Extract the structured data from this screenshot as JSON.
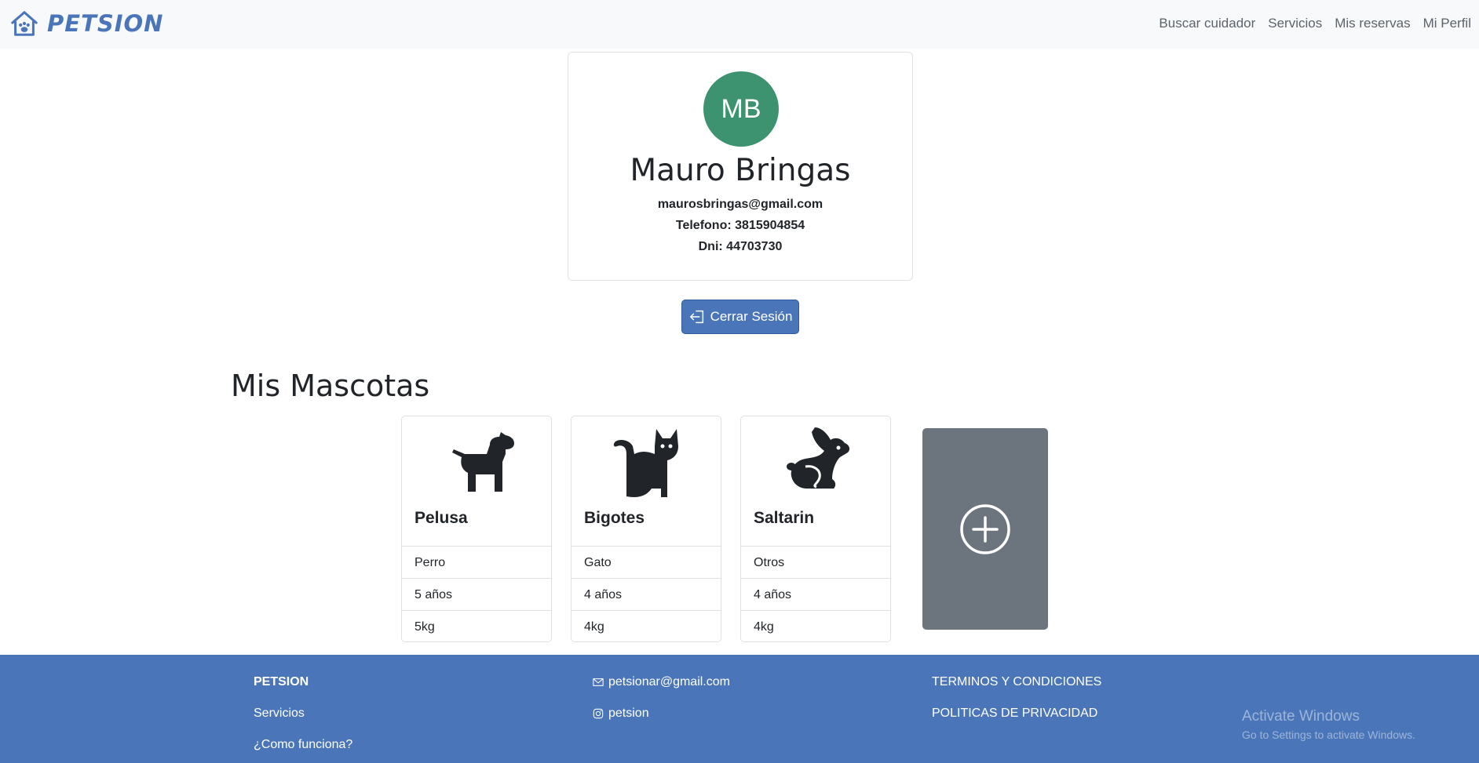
{
  "navbar": {
    "brand": "PETSION",
    "links": [
      "Buscar cuidador",
      "Servicios",
      "Mis reservas",
      "Mi Perfil"
    ]
  },
  "profile": {
    "initials": "MB",
    "name": "Mauro Bringas",
    "email": "maurosbringas@gmail.com",
    "phone": "Telefono: 3815904854",
    "dni": "Dni: 44703730",
    "avatar_color": "#3d9270"
  },
  "logout_label": "Cerrar Sesión",
  "pets_title": "Mis Mascotas",
  "pets": [
    {
      "name": "Pelusa",
      "type": "Perro",
      "age": "5 años",
      "weight": "5kg",
      "icon": "dog-icon"
    },
    {
      "name": "Bigotes",
      "type": "Gato",
      "age": "4 años",
      "weight": "4kg",
      "icon": "cat-icon"
    },
    {
      "name": "Saltarin",
      "type": "Otros",
      "age": "4 años",
      "weight": "4kg",
      "icon": "rabbit-icon"
    }
  ],
  "add_pet_icon": "plus-circle-icon",
  "footer": {
    "brand": "PETSION",
    "servicios": "Servicios",
    "como_funciona": "¿Como funciona?",
    "email": "petsionar@gmail.com",
    "instagram": "petsion",
    "terminos": "TERMINOS Y CONDICIONES",
    "privacidad": "POLITICAS DE PRIVACIDAD"
  },
  "watermark": {
    "line1": "Activate Windows",
    "line2": "Go to Settings to activate Windows."
  },
  "colors": {
    "primary": "#4a76b9",
    "add_card": "#6c757d",
    "navbar_bg": "#f8f9fa"
  }
}
